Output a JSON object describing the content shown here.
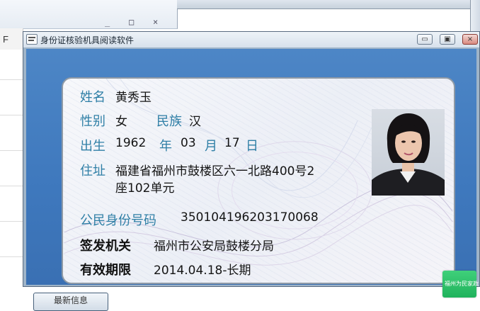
{
  "background_window": {
    "controls": [
      "_",
      "□",
      "×"
    ],
    "column_header": "F"
  },
  "window": {
    "title": "身份证核验机具阅读软件",
    "buttons": {
      "minimize": "▭",
      "maximize": "▣",
      "close": "×"
    }
  },
  "card": {
    "name_label": "姓名",
    "name_value": "黄秀玉",
    "sex_label": "性别",
    "sex_value": "女",
    "ethnicity_label": "民族",
    "ethnicity_value": "汉",
    "birth_label": "出生",
    "birth_year": "1962",
    "birth_year_unit": "年",
    "birth_month": "03",
    "birth_month_unit": "月",
    "birth_day": "17",
    "birth_day_unit": "日",
    "address_label": "住址",
    "address_line1": "福建省福州市鼓楼区六一北路400号2",
    "address_line2": "座102单元",
    "id_label": "公民身份号码",
    "id_value": "350104196203170068",
    "issuer_label": "签发机关",
    "issuer_value": "福州市公安局鼓楼分局",
    "validity_label": "有效期限",
    "validity_value": "2014.04.18-长期"
  },
  "footer": {
    "refresh_button": "最新信息",
    "badge_text": "福州为民家政"
  }
}
